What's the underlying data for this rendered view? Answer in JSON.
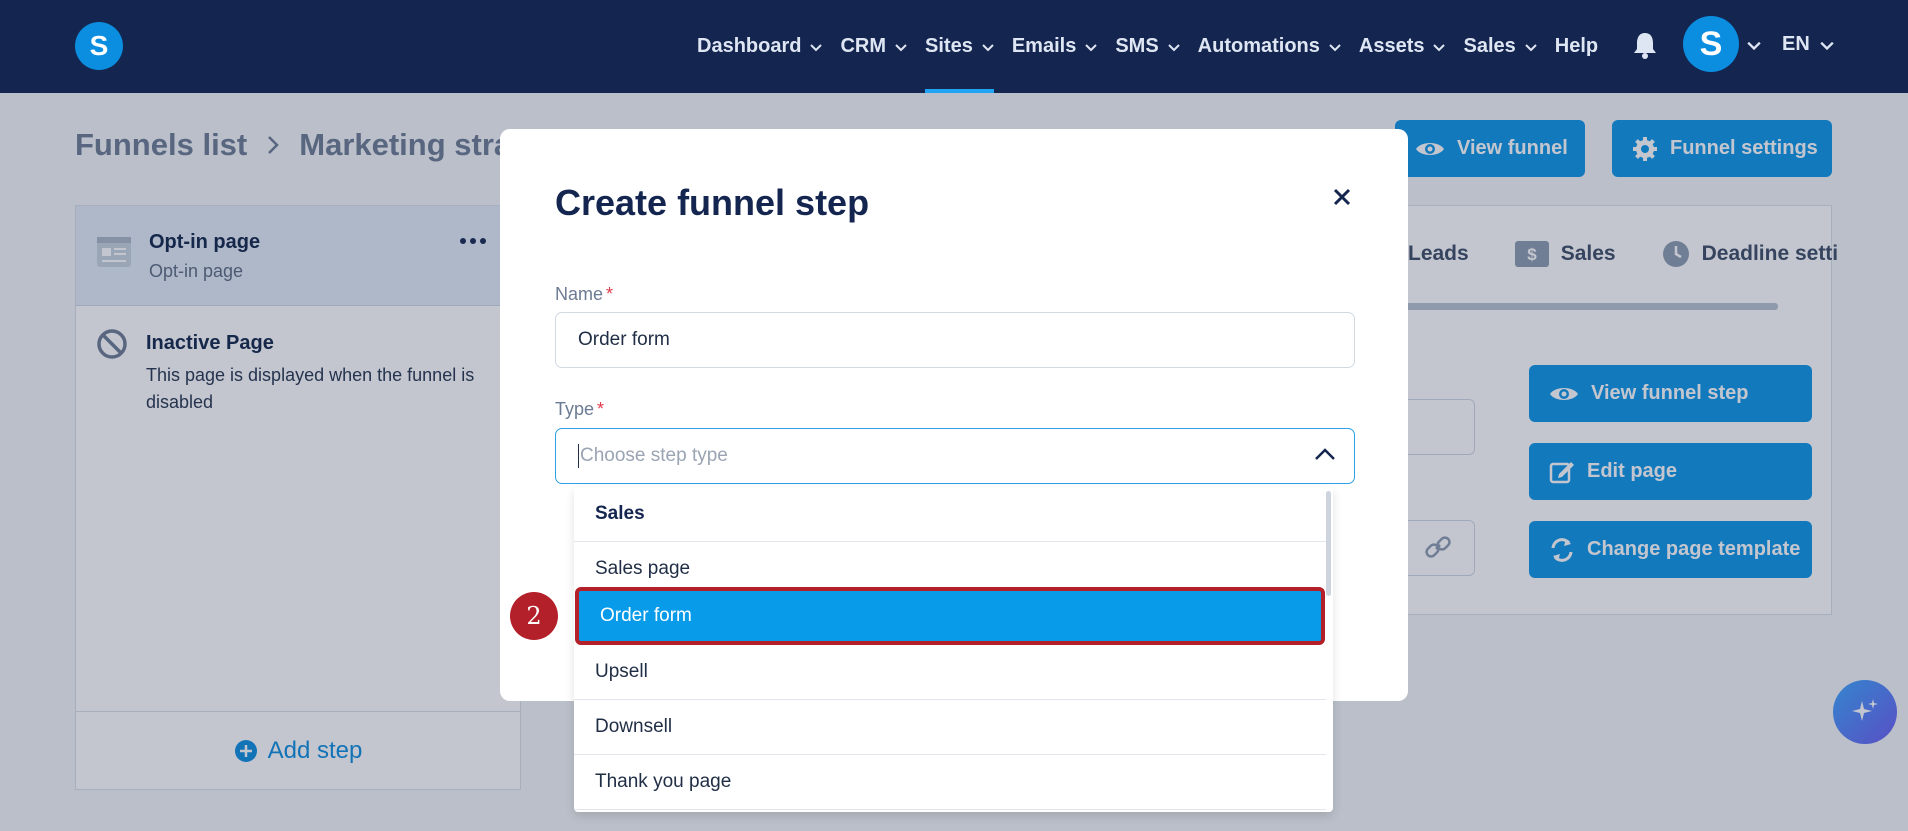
{
  "nav": {
    "logo": "S",
    "items": [
      {
        "label": "Dashboard",
        "has_menu": true
      },
      {
        "label": "CRM",
        "has_menu": true
      },
      {
        "label": "Sites",
        "has_menu": true,
        "active": true
      },
      {
        "label": "Emails",
        "has_menu": true
      },
      {
        "label": "SMS",
        "has_menu": true
      },
      {
        "label": "Automations",
        "has_menu": true
      },
      {
        "label": "Assets",
        "has_menu": true
      },
      {
        "label": "Sales",
        "has_menu": true
      },
      {
        "label": "Help",
        "has_menu": false
      }
    ],
    "avatar": "S",
    "language": "EN"
  },
  "page": {
    "breadcrumb_root": "Funnels list",
    "breadcrumb_current": "Marketing strat",
    "view_funnel": "View funnel",
    "funnel_settings": "Funnel settings",
    "steps": [
      {
        "title": "Opt-in page",
        "subtitle": "Opt-in page"
      }
    ],
    "inactive_title": "Inactive Page",
    "inactive_desc": "This page is displayed when the funnel is disabled",
    "add_step": "Add step",
    "tabs": [
      "Leads",
      "Sales",
      "Deadline setti"
    ],
    "view_funnel_step": "View funnel step",
    "edit_page": "Edit page",
    "change_template": "Change page template"
  },
  "modal": {
    "title": "Create funnel step",
    "name_label": "Name",
    "name_value": "Order form",
    "type_label": "Type",
    "type_placeholder": "Choose step type",
    "dropdown": {
      "group": "Sales",
      "options": [
        "Sales page",
        "Order form",
        "Upsell",
        "Downsell",
        "Thank you page"
      ],
      "highlighted": "Order form"
    }
  },
  "annotation": {
    "step_number": "2"
  },
  "colors": {
    "nav_bg": "#14264f",
    "primary": "#0b95e8",
    "highlight_border": "#b3202a"
  }
}
